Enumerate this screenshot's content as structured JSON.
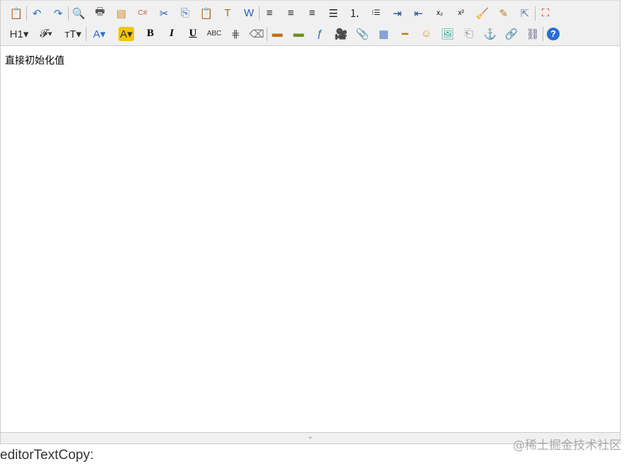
{
  "toolbar": {
    "rows": [
      [
        {
          "name": "source-button",
          "glyph": "📋",
          "color": "#444"
        },
        {
          "sep": true
        },
        {
          "name": "undo-button",
          "glyph": "↶",
          "color": "#2f6fd0"
        },
        {
          "name": "redo-button",
          "glyph": "↷",
          "color": "#2f6fd0"
        },
        {
          "sep": true
        },
        {
          "name": "preview-button",
          "glyph": "🔍",
          "color": "#888"
        },
        {
          "name": "print-button",
          "glyph": "🖶",
          "color": "#555"
        },
        {
          "name": "template-button",
          "glyph": "▤",
          "color": "#d08a20"
        },
        {
          "name": "code-button",
          "glyph": "C#",
          "color": "#c55",
          "small": true
        },
        {
          "name": "cut-button",
          "glyph": "✂",
          "color": "#2a5fc0"
        },
        {
          "name": "copy-button",
          "glyph": "⎘",
          "color": "#3a7ad0"
        },
        {
          "name": "paste-button",
          "glyph": "📋",
          "color": "#c9a040"
        },
        {
          "name": "plainpaste-button",
          "glyph": "T",
          "color": "#a07020"
        },
        {
          "name": "wordpaste-button",
          "glyph": "W",
          "color": "#2a5fc0"
        },
        {
          "sep": true
        },
        {
          "name": "justifyleft-button",
          "glyph": "≡",
          "color": "#222"
        },
        {
          "name": "justifycenter-button",
          "glyph": "≡",
          "color": "#222"
        },
        {
          "name": "justifyright-button",
          "glyph": "≡",
          "color": "#222"
        },
        {
          "name": "justifyfull-button",
          "glyph": "☰",
          "color": "#222"
        },
        {
          "name": "insertorderedlist-button",
          "glyph": "⒈",
          "color": "#222"
        },
        {
          "name": "insertunorderedlist-button",
          "glyph": "⁝☰",
          "color": "#222",
          "small": true
        },
        {
          "name": "indent-button",
          "glyph": "⇥",
          "color": "#1a4a90"
        },
        {
          "name": "outdent-button",
          "glyph": "⇤",
          "color": "#1a4a90"
        },
        {
          "name": "subscript-button",
          "glyph": "x₂",
          "color": "#000",
          "small": true
        },
        {
          "name": "superscript-button",
          "glyph": "x²",
          "color": "#000",
          "small": true
        },
        {
          "name": "clearhtml-button",
          "glyph": "🧹",
          "color": "#e0a020"
        },
        {
          "name": "quickformat-button",
          "glyph": "✎",
          "color": "#b08030"
        },
        {
          "name": "selectall-button",
          "glyph": "⇱",
          "color": "#6080b0"
        },
        {
          "sep": true
        },
        {
          "name": "fullscreen-button",
          "glyph": "⛶",
          "color": "#c33"
        }
      ],
      [
        {
          "name": "formatblock-button",
          "label": "H1▾",
          "color": "#333",
          "wide": true
        },
        {
          "name": "fontname-button",
          "label": "𝓕▾",
          "color": "#333",
          "wide": true
        },
        {
          "name": "fontsize-button",
          "label": "тT▾",
          "color": "#333",
          "wide": true
        },
        {
          "sep": true
        },
        {
          "name": "forecolor-button",
          "label": "A▾",
          "color": "#2a6fd0",
          "wide": true
        },
        {
          "name": "hilitecolor-button",
          "label": "A▾",
          "color": "#333",
          "bg": "#f6c400",
          "wide": true
        },
        {
          "name": "bold-button",
          "label": "B",
          "color": "#000",
          "bold": true
        },
        {
          "name": "italic-button",
          "label": "I",
          "color": "#000",
          "italic": true
        },
        {
          "name": "underline-button",
          "label": "U",
          "color": "#000",
          "underline": true
        },
        {
          "name": "strikethrough-button",
          "label": "ABC",
          "color": "#333",
          "small": true
        },
        {
          "name": "lineheight-button",
          "glyph": "⋕",
          "color": "#555"
        },
        {
          "name": "removeformat-button",
          "glyph": "⌫",
          "color": "#777"
        },
        {
          "sep": true
        },
        {
          "name": "image-button",
          "glyph": "▬",
          "color": "#c07010"
        },
        {
          "name": "multiimage-button",
          "glyph": "▬",
          "color": "#6a9020"
        },
        {
          "name": "flash-button",
          "glyph": "ƒ",
          "color": "#2a5fc0"
        },
        {
          "name": "media-button",
          "glyph": "🎥",
          "color": "#557"
        },
        {
          "name": "insertfile-button",
          "glyph": "📎",
          "color": "#888"
        },
        {
          "name": "table-button",
          "glyph": "▦",
          "color": "#4a7ac0"
        },
        {
          "name": "hr-button",
          "glyph": "━",
          "color": "#b08020"
        },
        {
          "name": "emoticons-button",
          "glyph": "☺",
          "color": "#e0a000"
        },
        {
          "name": "baidumap-button",
          "glyph": "🖼",
          "color": "#4a9"
        },
        {
          "name": "pagebreak-button",
          "glyph": "⎗",
          "color": "#999"
        },
        {
          "name": "anchor-button",
          "glyph": "⚓",
          "color": "#888"
        },
        {
          "name": "link-button",
          "glyph": "🔗",
          "color": "#557"
        },
        {
          "name": "unlink-button",
          "glyph": "⛓",
          "color": "#557"
        },
        {
          "sep": true
        },
        {
          "name": "about-button",
          "glyph": "?",
          "color": "#fff",
          "circle": "#2a6fd0"
        }
      ]
    ]
  },
  "editor": {
    "content": "直接初始化值",
    "resize_glyph": "÷"
  },
  "below": {
    "label": "editorTextCopy:"
  },
  "watermark": "@稀土掘金技术社区"
}
